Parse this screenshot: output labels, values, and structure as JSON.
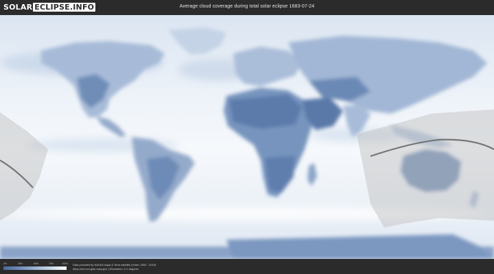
{
  "header": {
    "logo": {
      "part1": "SOLAR",
      "part2": "ECLIPSE.INFO"
    },
    "title": "Average cloud coverage during total solar eclipse 1683-07-24"
  },
  "map": {
    "layer": "cloud-coverage",
    "colors": {
      "ocean_cloud": "#eef3f9",
      "land_clear": "#6f8db8",
      "desert_clear": "#5b7aaa",
      "eclipse_band": "#c9c9c9",
      "central_line": "#6a6a6a"
    }
  },
  "footer": {
    "scale": {
      "ticks": [
        "0%",
        "25%",
        "50%",
        "75%",
        "100%"
      ]
    },
    "credit_line1": "Data provided by NASA's Aqua & Terra satellite (Years: 2000 - 2019)",
    "credit_line2": "https://neo.sci.gsfc.nasa.gov | Resolution: 0.1 degrees"
  }
}
